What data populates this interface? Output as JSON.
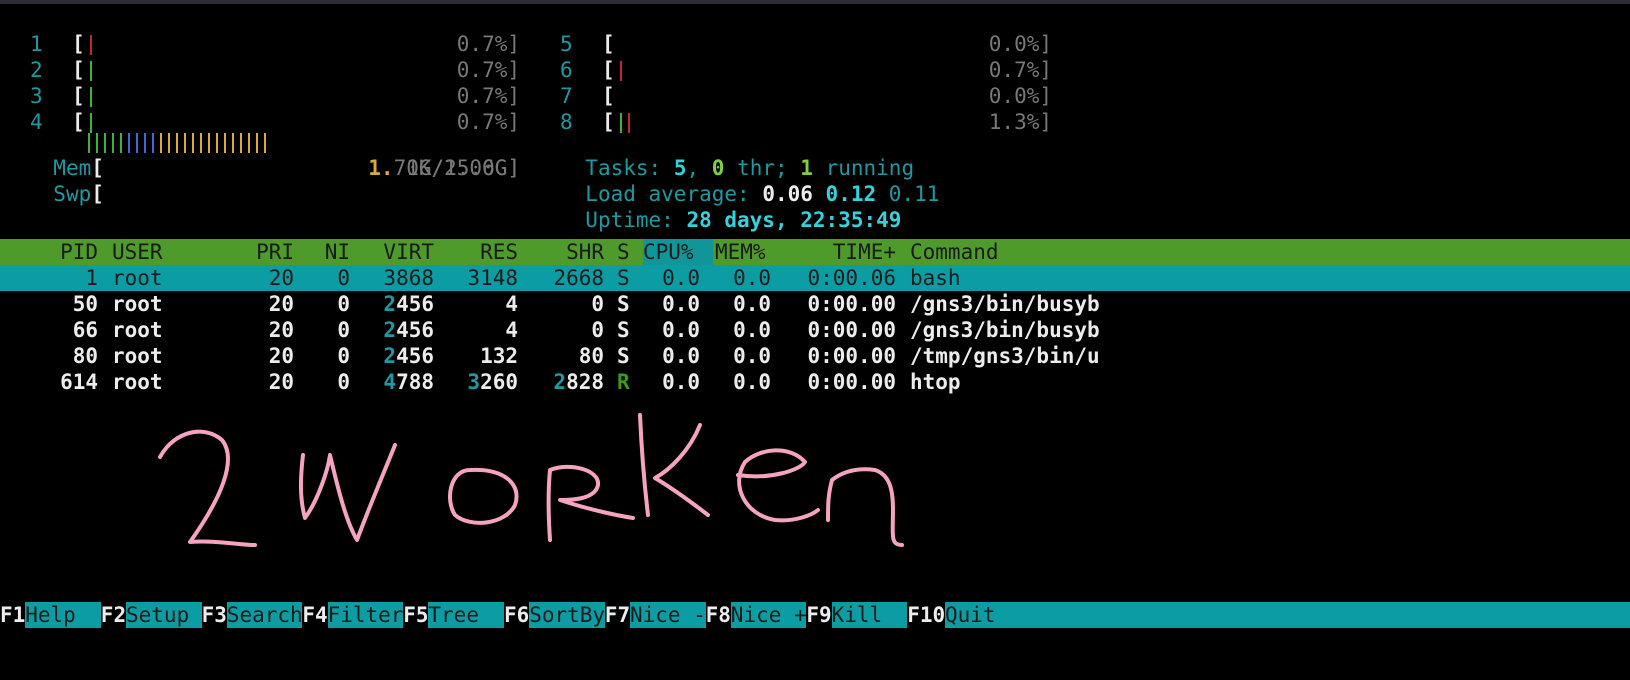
{
  "meters": {
    "cpus_left": [
      {
        "num": "1",
        "pct": "0.7%]",
        "ticks": [
          "red"
        ]
      },
      {
        "num": "2",
        "pct": "0.7%]",
        "ticks": [
          "grn"
        ]
      },
      {
        "num": "3",
        "pct": "0.7%]",
        "ticks": [
          "grn"
        ]
      },
      {
        "num": "4",
        "pct": "0.7%]",
        "ticks": [
          "grn"
        ]
      }
    ],
    "cpus_right": [
      {
        "num": "5",
        "pct": "0.0%]",
        "ticks": []
      },
      {
        "num": "6",
        "pct": "0.7%]",
        "ticks": [
          "red"
        ]
      },
      {
        "num": "7",
        "pct": "0.0%]",
        "ticks": []
      },
      {
        "num": "8",
        "pct": "1.3%]",
        "ticks": [
          "grn",
          "red"
        ]
      }
    ],
    "mem": {
      "label": "Mem",
      "value_hl": "1.",
      "value": "71G/15.6G]",
      "fraction": 0.11
    },
    "swp": {
      "label": "Swp",
      "value": "0K/2.00G]",
      "fraction": 0.0
    }
  },
  "summary": {
    "tasks_label": "Tasks: ",
    "tasks": "5",
    "comma": ", ",
    "thr": "0",
    "thr_label": " thr; ",
    "running": "1",
    "running_label": " running",
    "load_label": "Load average: ",
    "load1": "0.06",
    "load5": "0.12",
    "load15": "0.11",
    "uptime_label": "Uptime: ",
    "uptime": "28 days, 22:35:49"
  },
  "table": {
    "headers": {
      "pid": "PID",
      "user": "USER",
      "pri": "PRI",
      "ni": "NI",
      "virt": "VIRT",
      "res": "RES",
      "shr": "SHR",
      "s": "S",
      "cpu": "CPU%",
      "mem": "MEM%",
      "time": "TIME+",
      "cmd": "Command"
    },
    "rows": [
      {
        "pid": "1",
        "user": "root",
        "pri": "20",
        "ni": "0",
        "virt_a": "",
        "virt_b": "3868",
        "res_a": "",
        "res_b": "3148",
        "shr_a": "",
        "shr_b": "2668",
        "s": "S",
        "cpu": "0.0",
        "mem": "0.0",
        "time": "0:00.06",
        "cmd": "bash"
      },
      {
        "pid": "50",
        "user": "root",
        "pri": "20",
        "ni": "0",
        "virt_a": "2",
        "virt_b": "456",
        "res_a": "",
        "res_b": "4",
        "shr_a": "",
        "shr_b": "0",
        "s": "S",
        "cpu": "0.0",
        "mem": "0.0",
        "time": "0:00.00",
        "cmd": "/gns3/bin/busyb"
      },
      {
        "pid": "66",
        "user": "root",
        "pri": "20",
        "ni": "0",
        "virt_a": "2",
        "virt_b": "456",
        "res_a": "",
        "res_b": "4",
        "shr_a": "",
        "shr_b": "0",
        "s": "S",
        "cpu": "0.0",
        "mem": "0.0",
        "time": "0:00.00",
        "cmd": "/gns3/bin/busyb"
      },
      {
        "pid": "80",
        "user": "root",
        "pri": "20",
        "ni": "0",
        "virt_a": "2",
        "virt_b": "456",
        "res_a": "",
        "res_b": "132",
        "shr_a": "",
        "shr_b": "80",
        "s": "S",
        "cpu": "0.0",
        "mem": "0.0",
        "time": "0:00.00",
        "cmd": "/tmp/gns3/bin/u"
      },
      {
        "pid": "614",
        "user": "root",
        "pri": "20",
        "ni": "0",
        "virt_a": "4",
        "virt_b": "788",
        "res_a": "3",
        "res_b": "260",
        "shr_a": "2",
        "shr_b": "828",
        "s": "R",
        "cpu": "0.0",
        "mem": "0.0",
        "time": "0:00.00",
        "cmd": "htop"
      }
    ]
  },
  "fkeys": [
    {
      "key": "F1",
      "label": "Help  "
    },
    {
      "key": "F2",
      "label": "Setup "
    },
    {
      "key": "F3",
      "label": "Search"
    },
    {
      "key": "F4",
      "label": "Filter"
    },
    {
      "key": "F5",
      "label": "Tree  "
    },
    {
      "key": "F6",
      "label": "SortBy"
    },
    {
      "key": "F7",
      "label": "Nice -"
    },
    {
      "key": "F8",
      "label": "Nice +"
    },
    {
      "key": "F9",
      "label": "Kill  "
    },
    {
      "key": "F10",
      "label": "Quit"
    }
  ],
  "annotation": {
    "text": "2 worker",
    "color": "#f5a3c0"
  }
}
